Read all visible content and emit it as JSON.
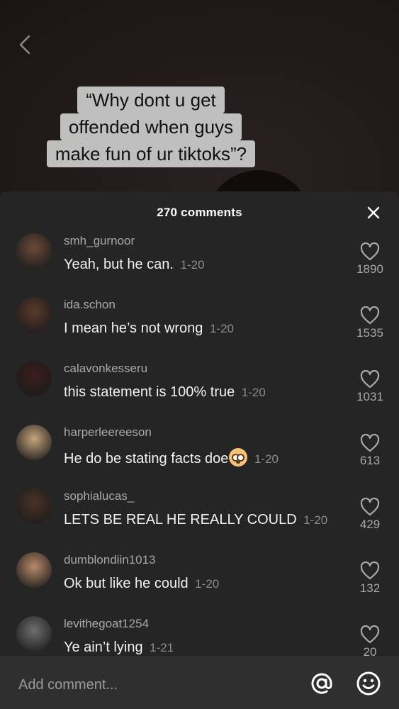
{
  "caption": {
    "lines": [
      "“Why dont u get",
      "offended when guys",
      "make fun of ur tiktoks”?"
    ]
  },
  "sheet": {
    "title": "270 comments"
  },
  "comments": [
    {
      "username": "smh_gurnoor",
      "text": "Yeah, but he can.",
      "date": "1-20",
      "likes": "1890",
      "avatar_color": "#6b4a3a"
    },
    {
      "username": "ida.schon",
      "text": "I mean he’s not wrong",
      "date": "1-20",
      "likes": "1535",
      "avatar_color": "#5a3a2a"
    },
    {
      "username": "calavonkesseru",
      "text": "this statement is 100% true",
      "date": "1-20",
      "likes": "1031",
      "avatar_color": "#3a1e1a"
    },
    {
      "username": "harperleereeson",
      "text": "He do be stating facts doe",
      "date": "1-20",
      "likes": "613",
      "avatar_color": "#c7a57c",
      "emoji": "flushed-face"
    },
    {
      "username": "sophialucas_",
      "text": "LETS BE REAL HE REALLY COULD",
      "date": "1-20",
      "likes": "429",
      "avatar_color": "#4a3326"
    },
    {
      "username": "dumblondiin1013",
      "text": "Ok but like he could",
      "date": "1-20",
      "likes": "132",
      "avatar_color": "#b98a6a"
    },
    {
      "username": "levithegoat1254",
      "text": "Ye ain’t lying",
      "date": "1-21",
      "likes": "20",
      "avatar_color": "#6e6e6e"
    }
  ],
  "input": {
    "placeholder": "Add comment..."
  },
  "colors": {
    "sheet_bg": "#252525",
    "username": "#a9a9a9",
    "date": "#8c8c8c"
  }
}
